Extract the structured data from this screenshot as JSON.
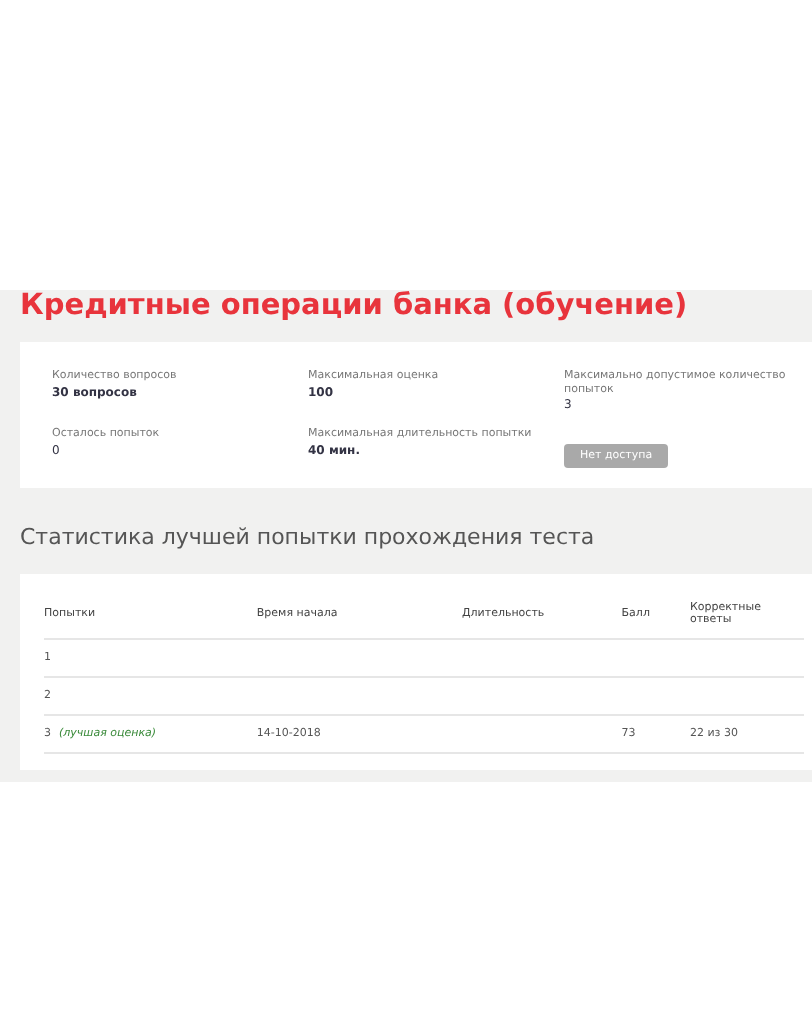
{
  "title": "Кредитные операции банка (обучение)",
  "info": [
    {
      "label": "Количество вопросов",
      "value": "30 вопросов",
      "kind": "strong"
    },
    {
      "label": "Максимальная оценка",
      "value": "100",
      "kind": "strong"
    },
    {
      "label": "Максимально допустимое количество попыток",
      "value": "3",
      "kind": "plain"
    },
    {
      "label": "Осталось попыток",
      "value": "0",
      "kind": "plain"
    },
    {
      "label": "Максимальная длительность попытки",
      "value": "40 мин.",
      "kind": "strong"
    },
    {
      "kind": "button",
      "value": "Нет доступа",
      "disabled": true
    }
  ],
  "stats_title": "Статистика лучшей попытки прохождения теста",
  "table": {
    "columns": [
      "Попытки",
      "Время начала",
      "Длительность",
      "Балл",
      "Корректные ответы"
    ],
    "rows": [
      {
        "cells": [
          "1",
          "",
          "",
          "",
          ""
        ]
      },
      {
        "cells": [
          "2",
          "",
          "",
          "",
          ""
        ]
      },
      {
        "cells": [
          "3",
          "14-10-2018",
          "",
          "73",
          "22 из 30"
        ],
        "note": "(лучшая оценка)"
      }
    ]
  }
}
